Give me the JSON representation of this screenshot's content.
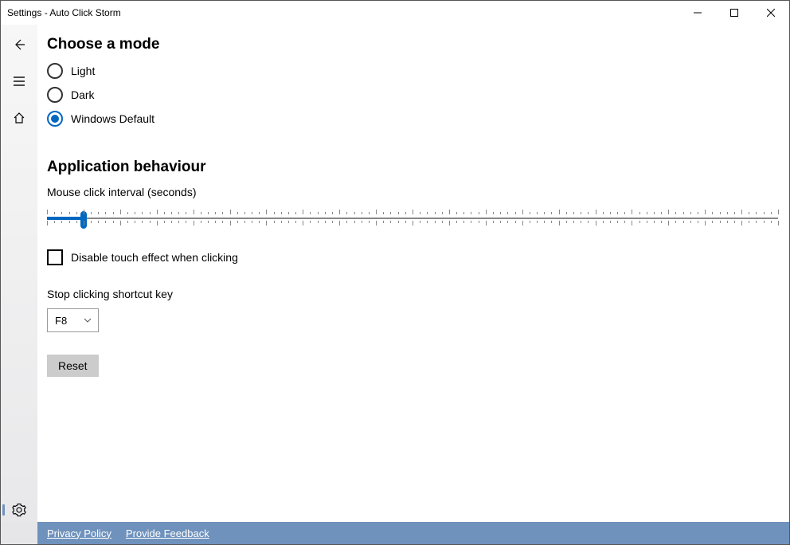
{
  "window": {
    "title": "Settings - Auto Click Storm"
  },
  "mode": {
    "heading": "Choose a mode",
    "options": {
      "light": "Light",
      "dark": "Dark",
      "default": "Windows Default"
    },
    "selected": "default"
  },
  "behaviour": {
    "heading": "Application behaviour",
    "interval_label": "Mouse click interval (seconds)",
    "slider": {
      "min": 0,
      "max": 100,
      "value": 5
    },
    "disable_touch_label": "Disable touch effect when clicking",
    "disable_touch_checked": false,
    "shortcut_label": "Stop clicking shortcut key",
    "shortcut_value": "F8",
    "reset_label": "Reset"
  },
  "footer": {
    "privacy": "Privacy Policy",
    "feedback": "Provide Feedback"
  }
}
